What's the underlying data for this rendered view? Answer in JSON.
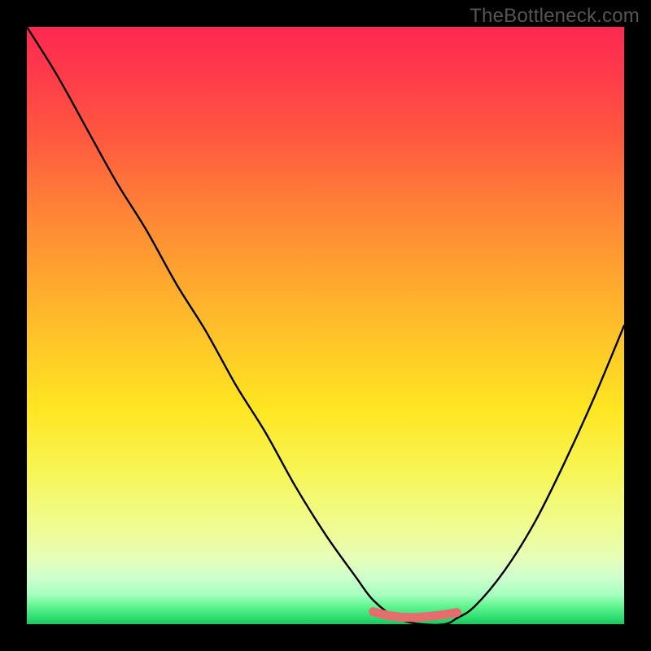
{
  "watermark": "TheBottleneck.com",
  "colors": {
    "frame": "#000000",
    "curve": "#000000",
    "marker_fill": "#e46e6e",
    "marker_stroke": "#d85a5a"
  },
  "chart_data": {
    "type": "line",
    "title": "",
    "xlabel": "",
    "ylabel": "",
    "xlim": [
      0,
      100
    ],
    "ylim": [
      0,
      100
    ],
    "grid": false,
    "gradient_direction": "top-to-bottom",
    "gradient_stops": [
      {
        "pos": 0,
        "color": "#ff2850"
      },
      {
        "pos": 50,
        "color": "#ffd028"
      },
      {
        "pos": 85,
        "color": "#f0fd90"
      },
      {
        "pos": 100,
        "color": "#18c85c"
      }
    ],
    "series": [
      {
        "name": "bottleneck-curve",
        "description": "Compatibility curve (higher = worse match). Values read from vertical position; x is relative horizontal position.",
        "x": [
          0,
          5,
          10,
          15,
          20,
          25,
          30,
          35,
          40,
          45,
          50,
          55,
          58,
          62,
          66,
          70,
          72,
          75,
          80,
          85,
          90,
          95,
          100
        ],
        "values": [
          100,
          92,
          83,
          74,
          66,
          57,
          49,
          40,
          32,
          23,
          15,
          8,
          4,
          1,
          0,
          0,
          1,
          3,
          9,
          17,
          27,
          38,
          50
        ]
      }
    ],
    "optimum_segment": {
      "description": "Highlighted pink segment at curve minimum indicating best-match range",
      "x_start": 58,
      "x_end": 72,
      "y": 1
    }
  }
}
